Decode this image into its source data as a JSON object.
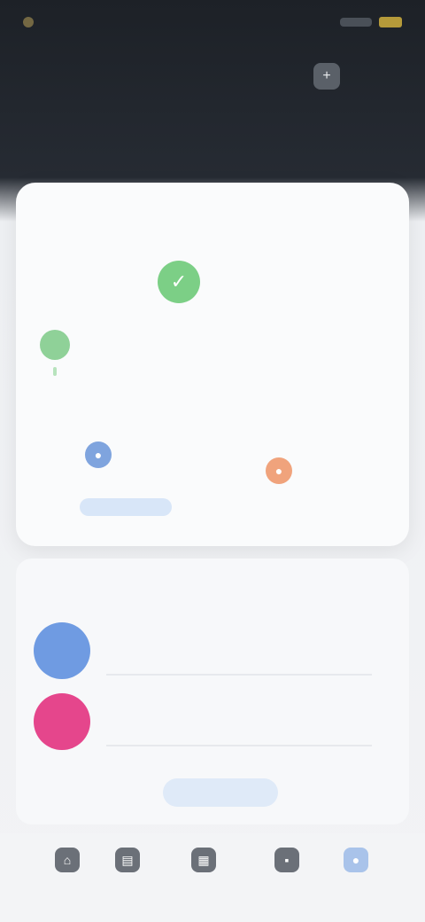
{
  "status_bar": {
    "time": "",
    "left_icon": "notification-dot-icon",
    "right_icons": [
      "signal-icon",
      "battery-icon"
    ]
  },
  "header": {
    "title": "",
    "action_icon": "add-icon",
    "action_glyph": "+",
    "action_label": ""
  },
  "summary_card": {
    "title": "",
    "score": {
      "icon": "check-circle-icon",
      "glyph": "✓",
      "value": "",
      "subtitle": ""
    },
    "week": [
      {
        "label": "",
        "value": "",
        "active": true
      },
      {
        "label": "",
        "value": "",
        "active": false
      },
      {
        "label": "",
        "value": "",
        "active": false
      },
      {
        "label": "",
        "value": "",
        "active": false
      },
      {
        "label": "",
        "value": "",
        "active": false
      },
      {
        "label": "",
        "value": "",
        "active": false
      },
      {
        "label": "",
        "value": "",
        "active": false
      }
    ],
    "stats": [
      {
        "icon": "person-icon",
        "glyph": "●",
        "caption": "",
        "value": "",
        "link_label": ""
      },
      {
        "icon": "flame-icon",
        "glyph": "●",
        "caption": "",
        "value": ""
      }
    ]
  },
  "activity": {
    "title": "",
    "items": [
      {
        "icon": "user-avatar-icon",
        "title": "",
        "subtitle": ""
      },
      {
        "icon": "user-avatar-icon",
        "title": "",
        "subtitle": ""
      }
    ],
    "more_label": ""
  },
  "bottom_nav": [
    {
      "icon": "home-icon",
      "glyph": "⌂",
      "label": "",
      "active": false
    },
    {
      "icon": "chart-icon",
      "glyph": "▤",
      "label": "",
      "active": false
    },
    {
      "icon": "calendar-icon",
      "glyph": "▦",
      "label": "",
      "active": false
    },
    {
      "icon": "message-icon",
      "glyph": "▪",
      "label": "",
      "active": false
    },
    {
      "icon": "profile-icon",
      "glyph": "●",
      "label": "",
      "active": true
    }
  ],
  "colors": {
    "accent_green": "#7ccf86",
    "accent_blue": "#6f9be2",
    "accent_orange": "#f0a37c",
    "accent_pink": "#e5468c",
    "header_bg": "#1d2127"
  }
}
